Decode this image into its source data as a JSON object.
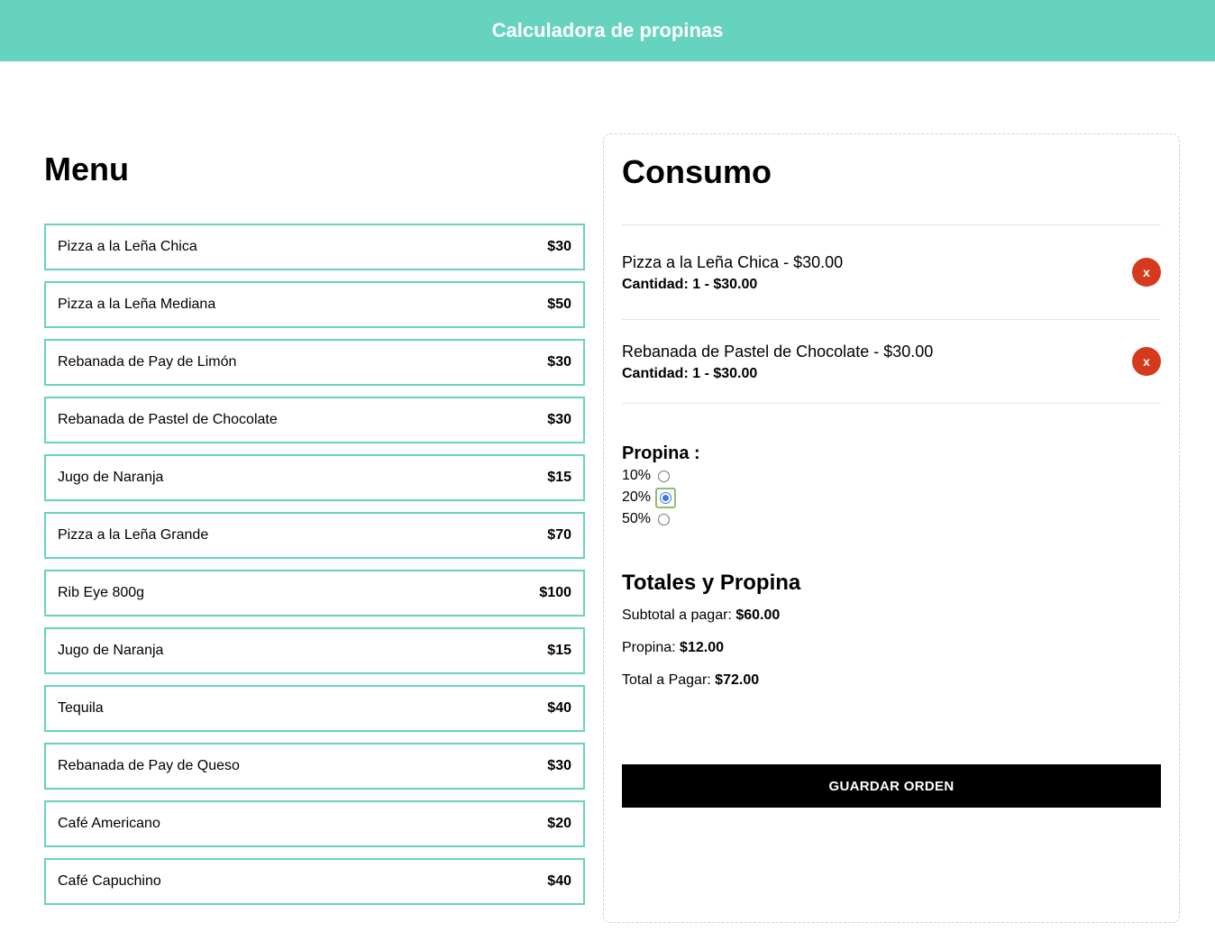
{
  "header": {
    "title": "Calculadora de propinas"
  },
  "menu": {
    "title": "Menu",
    "items": [
      {
        "name": "Pizza a la Leña Chica",
        "price": "$30"
      },
      {
        "name": "Pizza a la Leña Mediana",
        "price": "$50"
      },
      {
        "name": "Rebanada de Pay de Limón",
        "price": "$30"
      },
      {
        "name": "Rebanada de Pastel de Chocolate",
        "price": "$30"
      },
      {
        "name": "Jugo de Naranja",
        "price": "$15"
      },
      {
        "name": "Pizza a la Leña Grande",
        "price": "$70"
      },
      {
        "name": "Rib Eye 800g",
        "price": "$100"
      },
      {
        "name": "Jugo de Naranja",
        "price": "$15"
      },
      {
        "name": "Tequila",
        "price": "$40"
      },
      {
        "name": "Rebanada de Pay de Queso",
        "price": "$30"
      },
      {
        "name": "Café Americano",
        "price": "$20"
      },
      {
        "name": "Café Capuchino",
        "price": "$40"
      }
    ]
  },
  "consumo": {
    "title": "Consumo",
    "orders": [
      {
        "name": "Pizza a la Leña Chica - $30.00",
        "qty": "Cantidad: 1 - $30.00",
        "remove_label": "x"
      },
      {
        "name": "Rebanada de Pastel de Chocolate - $30.00",
        "qty": "Cantidad: 1 - $30.00",
        "remove_label": "x"
      }
    ],
    "propina": {
      "title": "Propina :",
      "options": [
        "10%",
        "20%",
        "50%"
      ],
      "selected": "20%"
    },
    "totales": {
      "title": "Totales y Propina",
      "subtotal_label": "Subtotal a pagar:",
      "subtotal_value": "$60.00",
      "propina_label": "Propina:",
      "propina_value": "$12.00",
      "total_label": "Total a Pagar:",
      "total_value": "$72.00"
    },
    "save_label": "GUARDAR ORDEN"
  },
  "colors": {
    "accent": "#66d3bf",
    "remove": "#d63a1c",
    "button": "#000000"
  }
}
